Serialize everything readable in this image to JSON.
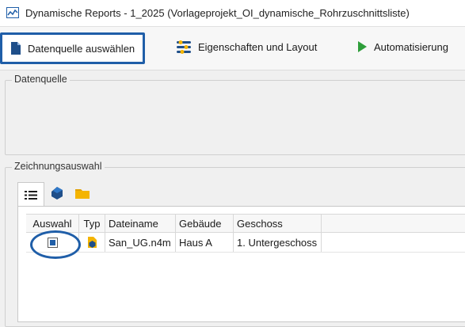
{
  "window": {
    "title": "Dynamische Reports - 1_2025 (Vorlageprojekt_OI_dynamische_Rohrzuschnittsliste)"
  },
  "toolbar": {
    "buttons": [
      {
        "label": "Datenquelle auswählen",
        "icon": "document-icon",
        "selected": true
      },
      {
        "label": "Eigenschaften und Layout",
        "icon": "sliders-icon",
        "selected": false
      },
      {
        "label": "Automatisierung",
        "icon": "play-icon",
        "selected": false
      }
    ]
  },
  "datenquelle": {
    "legend": "Datenquelle"
  },
  "zeichnungsauswahl": {
    "legend": "Zeichnungsauswahl",
    "tabs": [
      {
        "icon": "list-icon",
        "active": true
      },
      {
        "icon": "cube-icon",
        "active": false
      },
      {
        "icon": "folder-icon",
        "active": false
      }
    ],
    "table": {
      "columns": [
        "Auswahl",
        "Typ",
        "Dateiname",
        "Gebäude",
        "Geschoss"
      ],
      "rows": [
        {
          "checked": true,
          "type_icon": "drawing-file-icon",
          "dateiname": "San_UG.n4m",
          "gebaeude": "Haus A",
          "geschoss": "1. Untergeschoss"
        }
      ]
    }
  },
  "colors": {
    "accent": "#1f5ea8",
    "play_green": "#2e9e3a",
    "folder_yellow": "#f4b400"
  }
}
